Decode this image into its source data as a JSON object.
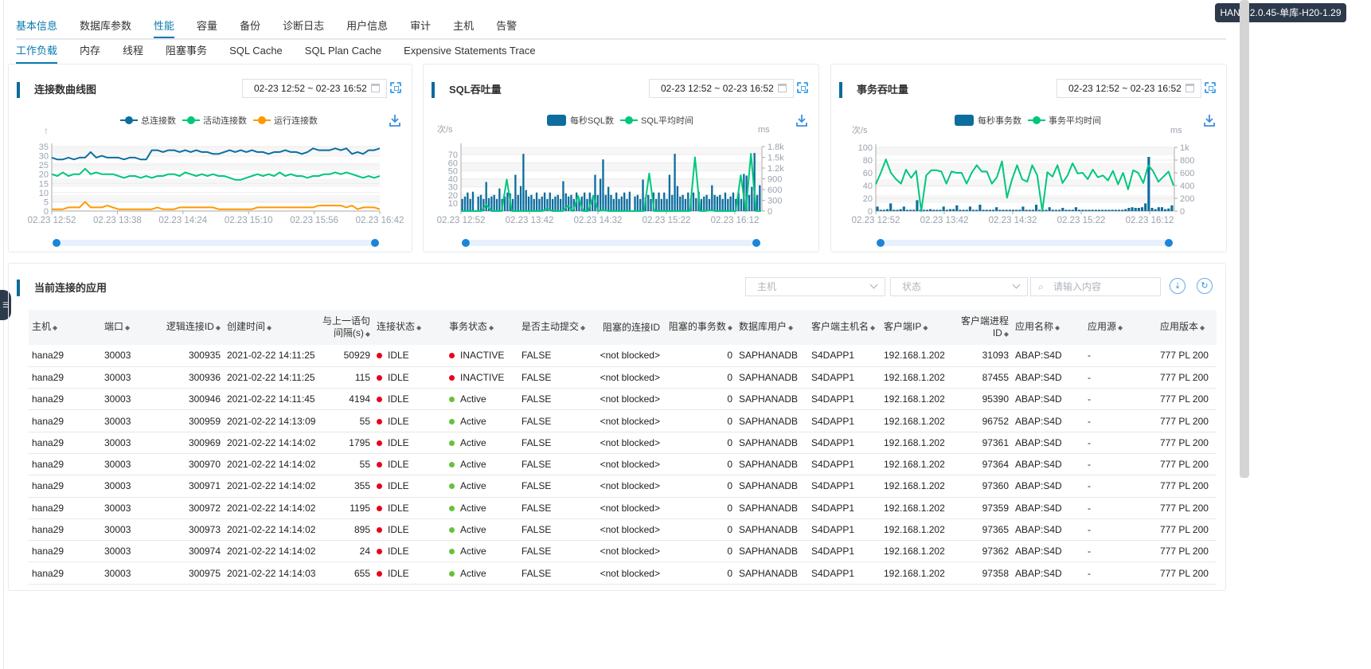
{
  "instance_badge": "HANA-2.0.45-单库-H20-1.29 ...",
  "tabs": [
    "基本信息",
    "数据库参数",
    "性能",
    "容量",
    "备份",
    "诊断日志",
    "用户信息",
    "审计",
    "主机",
    "告警"
  ],
  "active_tab": "性能",
  "subtabs": [
    "工作负载",
    "内存",
    "线程",
    "阻塞事务",
    "SQL Cache",
    "SQL Plan Cache",
    "Expensive Statements Trace"
  ],
  "active_subtab": "工作负载",
  "colors": {
    "accent": "#0a7ab0",
    "bar": "#0d6e9e",
    "green": "#00c77b",
    "orange": "#ff9900",
    "red": "#e8001c",
    "active_green": "#67c23a"
  },
  "chart_data": [
    {
      "type": "line",
      "title": "连接数曲线图",
      "date_range": "02-23 12:52 ~ 02-23 16:52",
      "ylim": [
        0,
        35
      ],
      "yticks": [
        0,
        5,
        10,
        15,
        20,
        25,
        30,
        35
      ],
      "xticks": [
        "02.23 12:52",
        "02.23 13:38",
        "02.23 14:24",
        "02.23 15:10",
        "02.23 15:56",
        "02.23 16:42"
      ],
      "xlim": [
        "02.23 12:52",
        "02.23 16:42"
      ],
      "grid": true,
      "legend": "top",
      "series": [
        {
          "name": "总连接数",
          "color": "#0d6e9e",
          "values": [
            29,
            28,
            28,
            29,
            28,
            29,
            29,
            32,
            29,
            30,
            29,
            29,
            29,
            28,
            29,
            29,
            28,
            28,
            33,
            33,
            32,
            33,
            33,
            32,
            33,
            32,
            33,
            32,
            32,
            31,
            31,
            32,
            33,
            32,
            33,
            32,
            33,
            32,
            32,
            31,
            32,
            32,
            33,
            32,
            32,
            31,
            32,
            34,
            33,
            33,
            33,
            34,
            33,
            34,
            31,
            32,
            31,
            33,
            33,
            34
          ]
        },
        {
          "name": "活动连接数",
          "color": "#00c77b",
          "values": [
            20,
            19,
            21,
            19,
            20,
            20,
            23,
            20,
            21,
            20,
            20,
            20,
            19,
            18,
            19,
            19,
            18,
            19,
            18,
            19,
            19,
            20,
            20,
            19,
            21,
            20,
            19,
            20,
            19,
            20,
            19,
            19,
            18,
            17,
            17,
            18,
            19,
            20,
            19,
            20,
            19,
            21,
            19,
            20,
            19,
            19,
            18,
            19,
            19,
            20,
            20,
            21,
            20,
            21,
            20,
            19,
            18,
            19,
            18,
            19
          ]
        },
        {
          "name": "运行连接数",
          "color": "#ff9900",
          "values": [
            1,
            1,
            1,
            2,
            2,
            2,
            5,
            2,
            2,
            2,
            3,
            2,
            1,
            1,
            1,
            1,
            1,
            1,
            1,
            2,
            1,
            1,
            1,
            2,
            2,
            2,
            2,
            2,
            2,
            2,
            1,
            1,
            1,
            1,
            1,
            1,
            1,
            2,
            2,
            2,
            2,
            2,
            2,
            2,
            2,
            2,
            2,
            2,
            3,
            3,
            3,
            3,
            3,
            2,
            3,
            1,
            2,
            2,
            2,
            1
          ]
        }
      ]
    },
    {
      "type": "bar+line",
      "title": "SQL吞吐量",
      "date_range": "02-23 12:52 ~ 02-23 16:52",
      "ylabel_left": "次/s",
      "ylabel_right": "ms",
      "ylim_left": [
        0,
        80
      ],
      "yticks_left": [
        10,
        20,
        30,
        40,
        50,
        60,
        70
      ],
      "ylim_right": [
        0,
        1800
      ],
      "yticks_right": [
        "0",
        "300",
        "600",
        "900",
        "1.2k",
        "1.5k",
        "1.8k"
      ],
      "xticks": [
        "02.23 12:52",
        "02.23 13:42",
        "02.23 14:32",
        "02.23 15:22",
        "02.23 16:12"
      ],
      "legend": "top",
      "series": [
        {
          "name": "每秒SQL数",
          "kind": "bar",
          "axis": "left",
          "color": "#0d6e9e",
          "values": [
            15,
            18,
            23,
            15,
            24,
            0,
            18,
            20,
            15,
            36,
            16,
            18,
            20,
            15,
            28,
            15,
            18,
            23,
            22,
            15,
            45,
            20,
            31,
            71,
            26,
            18,
            20,
            15,
            23,
            15,
            18,
            23,
            15,
            23,
            15,
            18,
            20,
            15,
            37,
            22,
            18,
            20,
            15,
            23,
            15,
            18,
            23,
            15,
            23,
            15,
            45,
            20,
            40,
            64,
            20,
            30,
            20,
            15,
            23,
            15,
            18,
            23,
            15,
            24,
            0,
            18,
            20,
            15,
            39,
            17,
            20,
            15,
            23,
            15,
            23,
            15,
            23,
            15,
            45,
            20,
            71,
            31,
            18,
            20,
            15,
            23,
            15,
            23,
            16,
            24,
            15,
            18,
            20,
            15,
            32,
            20,
            18,
            20,
            15,
            23,
            15,
            18,
            23,
            15,
            23,
            15,
            46,
            44,
            20,
            30,
            72,
            20,
            32
          ]
        },
        {
          "name": "SQL平均时间",
          "kind": "line",
          "axis": "right",
          "color": "#00c77b",
          "values": [
            0,
            0,
            0,
            0,
            0,
            180,
            0,
            0,
            0,
            880,
            0,
            0,
            0,
            0,
            0,
            0,
            0,
            80,
            0,
            0,
            0,
            150,
            0,
            420,
            0,
            0,
            430,
            0,
            30,
            0,
            0,
            0,
            0,
            0,
            0,
            0,
            0,
            1050,
            0,
            0,
            0,
            0,
            0,
            0,
            0,
            0,
            1500,
            0,
            0,
            30,
            0,
            0,
            0,
            0,
            0,
            1000,
            0,
            1600,
            0,
            0
          ]
        }
      ]
    },
    {
      "type": "bar+line",
      "title": "事务吞吐量",
      "date_range": "02-23 12:52 ~ 02-23 16:52",
      "ylabel_left": "次/s",
      "ylabel_right": "ms",
      "ylim_left": [
        0,
        100
      ],
      "yticks_left": [
        0,
        20,
        40,
        60,
        80,
        100
      ],
      "ylim_right": [
        0,
        1000
      ],
      "yticks_right": [
        "0",
        "200",
        "400",
        "600",
        "800",
        "1k"
      ],
      "xticks": [
        "02.23 12:52",
        "02.23 13:42",
        "02.23 14:32",
        "02.23 15:22",
        "02.23 16:12"
      ],
      "legend": "top",
      "series": [
        {
          "name": "每秒事务数",
          "kind": "bar",
          "axis": "left",
          "color": "#0d6e9e",
          "values": [
            7,
            2,
            2,
            3,
            12,
            2,
            2,
            3,
            7,
            2,
            2,
            2,
            17,
            2,
            2,
            2,
            3,
            2,
            2,
            2,
            7,
            2,
            3,
            3,
            9,
            2,
            2,
            2,
            7,
            2,
            2,
            10,
            2,
            2,
            2,
            2,
            6,
            2,
            2,
            2,
            2,
            2,
            2,
            2,
            7,
            2,
            2,
            2,
            10,
            2,
            2,
            2,
            6,
            2,
            2,
            2,
            5,
            2,
            2,
            2,
            6,
            2,
            2,
            2,
            2,
            2,
            2,
            2,
            2,
            2,
            2,
            2,
            2,
            2,
            2,
            3,
            5,
            6,
            5,
            5,
            6,
            12,
            85,
            5,
            3,
            6,
            6,
            3,
            4,
            9
          ]
        },
        {
          "name": "事务平均时间",
          "kind": "line",
          "axis": "right",
          "color": "#00c77b",
          "values": [
            420,
            600,
            810,
            600,
            500,
            430,
            650,
            520,
            630,
            0,
            560,
            640,
            640,
            620,
            430,
            620,
            600,
            600,
            430,
            600,
            720,
            620,
            620,
            430,
            530,
            780,
            210,
            500,
            720,
            500,
            460,
            720,
            560,
            0,
            610,
            540,
            720,
            440,
            560,
            750,
            590,
            600,
            500,
            650,
            530,
            560,
            480,
            630,
            420,
            600,
            340,
            640,
            600,
            440,
            720,
            620,
            460,
            540,
            620,
            400
          ]
        }
      ]
    }
  ],
  "table": {
    "title": "当前连接的应用",
    "filters": {
      "host_placeholder": "主机",
      "status_placeholder": "状态",
      "search_placeholder": "请输入内容"
    },
    "columns": [
      "主机",
      "端口",
      "逻辑连接ID",
      "创建时间",
      "与上一语句间隔(s)",
      "连接状态",
      "事务状态",
      "是否主动提交",
      "阻塞的连接ID",
      "阻塞的事务数",
      "数据库用户",
      "客户端主机名",
      "客户端IP",
      "客户端进程ID",
      "应用名称",
      "应用源",
      "应用版本"
    ],
    "rows": [
      [
        "hana29",
        "30003",
        "300935",
        "2021-02-22 14:11:25",
        "50929",
        "IDLE",
        "INACTIVE",
        "FALSE",
        "<not blocked>",
        "0",
        "SAPHANADB",
        "S4DAPP1",
        "192.168.1.202",
        "31093",
        "ABAP:S4D",
        "-",
        "777 PL 200"
      ],
      [
        "hana29",
        "30003",
        "300936",
        "2021-02-22 14:11:25",
        "115",
        "IDLE",
        "INACTIVE",
        "FALSE",
        "<not blocked>",
        "0",
        "SAPHANADB",
        "S4DAPP1",
        "192.168.1.202",
        "87455",
        "ABAP:S4D",
        "-",
        "777 PL 200"
      ],
      [
        "hana29",
        "30003",
        "300946",
        "2021-02-22 14:11:45",
        "4194",
        "IDLE",
        "Active",
        "FALSE",
        "<not blocked>",
        "0",
        "SAPHANADB",
        "S4DAPP1",
        "192.168.1.202",
        "95390",
        "ABAP:S4D",
        "-",
        "777 PL 200"
      ],
      [
        "hana29",
        "30003",
        "300959",
        "2021-02-22 14:13:09",
        "55",
        "IDLE",
        "Active",
        "FALSE",
        "<not blocked>",
        "0",
        "SAPHANADB",
        "S4DAPP1",
        "192.168.1.202",
        "96752",
        "ABAP:S4D",
        "-",
        "777 PL 200"
      ],
      [
        "hana29",
        "30003",
        "300969",
        "2021-02-22 14:14:02",
        "1795",
        "IDLE",
        "Active",
        "FALSE",
        "<not blocked>",
        "0",
        "SAPHANADB",
        "S4DAPP1",
        "192.168.1.202",
        "97361",
        "ABAP:S4D",
        "-",
        "777 PL 200"
      ],
      [
        "hana29",
        "30003",
        "300970",
        "2021-02-22 14:14:02",
        "55",
        "IDLE",
        "Active",
        "FALSE",
        "<not blocked>",
        "0",
        "SAPHANADB",
        "S4DAPP1",
        "192.168.1.202",
        "97364",
        "ABAP:S4D",
        "-",
        "777 PL 200"
      ],
      [
        "hana29",
        "30003",
        "300971",
        "2021-02-22 14:14:02",
        "355",
        "IDLE",
        "Active",
        "FALSE",
        "<not blocked>",
        "0",
        "SAPHANADB",
        "S4DAPP1",
        "192.168.1.202",
        "97360",
        "ABAP:S4D",
        "-",
        "777 PL 200"
      ],
      [
        "hana29",
        "30003",
        "300972",
        "2021-02-22 14:14:02",
        "1195",
        "IDLE",
        "Active",
        "FALSE",
        "<not blocked>",
        "0",
        "SAPHANADB",
        "S4DAPP1",
        "192.168.1.202",
        "97359",
        "ABAP:S4D",
        "-",
        "777 PL 200"
      ],
      [
        "hana29",
        "30003",
        "300973",
        "2021-02-22 14:14:02",
        "895",
        "IDLE",
        "Active",
        "FALSE",
        "<not blocked>",
        "0",
        "SAPHANADB",
        "S4DAPP1",
        "192.168.1.202",
        "97365",
        "ABAP:S4D",
        "-",
        "777 PL 200"
      ],
      [
        "hana29",
        "30003",
        "300974",
        "2021-02-22 14:14:02",
        "24",
        "IDLE",
        "Active",
        "FALSE",
        "<not blocked>",
        "0",
        "SAPHANADB",
        "S4DAPP1",
        "192.168.1.202",
        "97362",
        "ABAP:S4D",
        "-",
        "777 PL 200"
      ],
      [
        "hana29",
        "30003",
        "300975",
        "2021-02-22 14:14:03",
        "655",
        "IDLE",
        "Active",
        "FALSE",
        "<not blocked>",
        "0",
        "SAPHANADB",
        "S4DAPP1",
        "192.168.1.202",
        "97358",
        "ABAP:S4D",
        "-",
        "777 PL 200"
      ]
    ]
  }
}
